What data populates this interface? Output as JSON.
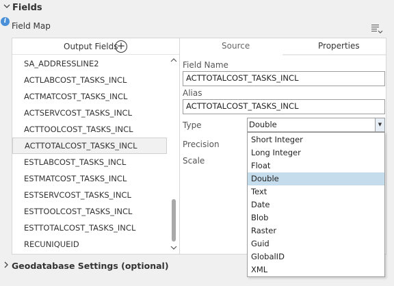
{
  "fields_section": {
    "title": "Fields",
    "chevron": "chevron-down-icon"
  },
  "field_map": {
    "label": "Field Map",
    "info_icon": "info-icon",
    "list_options_icon": "list-options-icon"
  },
  "output_fields": {
    "header": "Output Fields",
    "add_icon": "+",
    "items": [
      {
        "label": "SA_ADDRESSLINE2",
        "selected": false
      },
      {
        "label": "ACTLABCOST_TASKS_INCL",
        "selected": false
      },
      {
        "label": "ACTMATCOST_TASKS_INCL",
        "selected": false
      },
      {
        "label": "ACTSERVCOST_TASKS_INCL",
        "selected": false
      },
      {
        "label": "ACTTOOLCOST_TASKS_INCL",
        "selected": false
      },
      {
        "label": "ACTTOTALCOST_TASKS_INCL",
        "selected": true
      },
      {
        "label": "ESTLABCOST_TASKS_INCL",
        "selected": false
      },
      {
        "label": "ESTMATCOST_TASKS_INCL",
        "selected": false
      },
      {
        "label": "ESTSERVCOST_TASKS_INCL",
        "selected": false
      },
      {
        "label": "ESTTOOLCOST_TASKS_INCL",
        "selected": false
      },
      {
        "label": "ESTTOTALCOST_TASKS_INCL",
        "selected": false
      },
      {
        "label": "RECUNIQUEID",
        "selected": false
      }
    ]
  },
  "tabs": [
    {
      "label": "Source",
      "active": false
    },
    {
      "label": "Properties",
      "active": true
    }
  ],
  "properties": {
    "field_name_label": "Field Name",
    "field_name_value": "ACTTOTALCOST_TASKS_INCL",
    "alias_label": "Alias",
    "alias_value": "ACTTOTALCOST_TASKS_INCL",
    "type_label": "Type",
    "type_value": "Double",
    "precision_label": "Precision",
    "scale_label": "Scale"
  },
  "type_options": [
    {
      "label": "Short Integer",
      "selected": false
    },
    {
      "label": "Long Integer",
      "selected": false
    },
    {
      "label": "Float",
      "selected": false
    },
    {
      "label": "Double",
      "selected": true
    },
    {
      "label": "Text",
      "selected": false
    },
    {
      "label": "Date",
      "selected": false
    },
    {
      "label": "Blob",
      "selected": false
    },
    {
      "label": "Raster",
      "selected": false
    },
    {
      "label": "Guid",
      "selected": false
    },
    {
      "label": "GlobalID",
      "selected": false
    },
    {
      "label": "XML",
      "selected": false
    }
  ],
  "geodatabase_section": {
    "title": "Geodatabase Settings (optional)",
    "chevron": "chevron-right-icon"
  },
  "colors": {
    "selected_dropdown": "#c5dcec",
    "info_icon": "#4a90d9",
    "selected_row": "#f1f1f1"
  }
}
